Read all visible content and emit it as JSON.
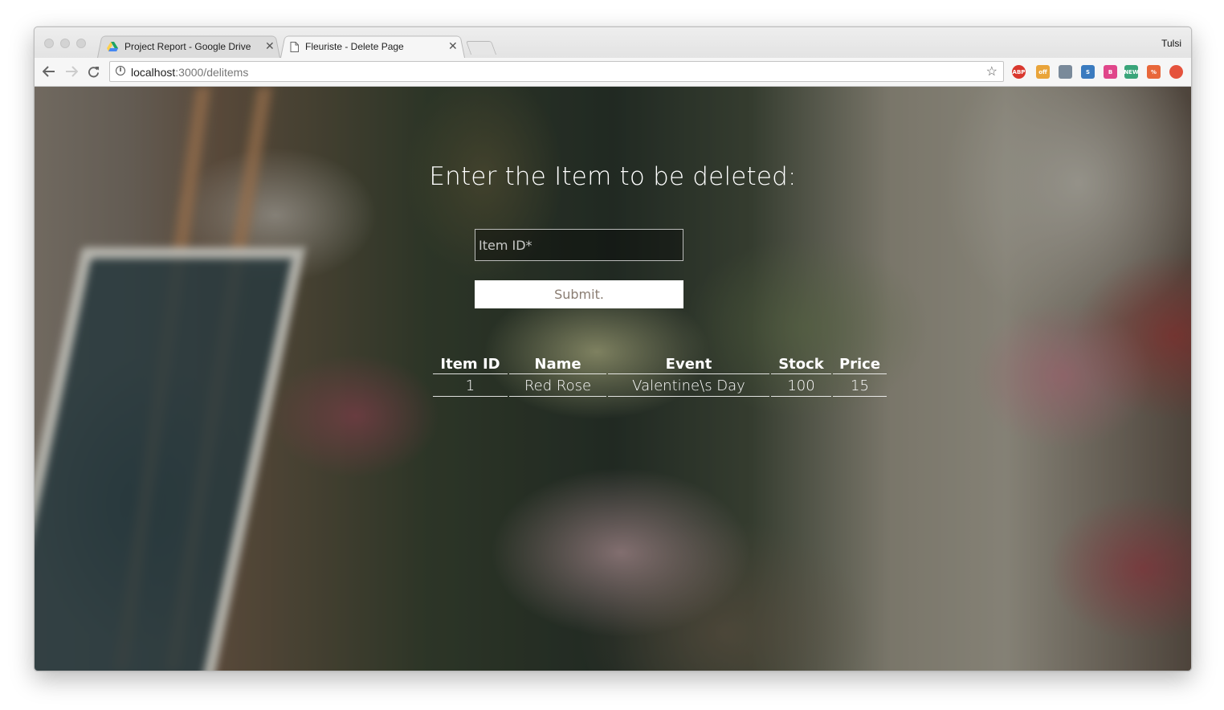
{
  "browser": {
    "tabs": [
      {
        "title": "Project Report - Google Drive",
        "icon": "google-drive-icon",
        "active": false
      },
      {
        "title": "Fleuriste - Delete Page",
        "icon": "document-icon",
        "active": true
      }
    ],
    "profile_name": "Tulsi",
    "url_host": "localhost",
    "url_path": ":3000/delitems",
    "extensions": [
      {
        "name": "adblock-plus-icon",
        "text": "ABP",
        "color": "#d9382e"
      },
      {
        "name": "coupon-icon",
        "text": "off",
        "color": "#e9a43a"
      },
      {
        "name": "extension-tools-icon",
        "text": "",
        "color": "#7a8a9a"
      },
      {
        "name": "extension-s-icon",
        "text": "S",
        "color": "#3b7bbf"
      },
      {
        "name": "extension-pink-icon",
        "text": "B",
        "color": "#e0468a"
      },
      {
        "name": "extension-new-icon",
        "text": "NEW",
        "color": "#3aa57a"
      },
      {
        "name": "extension-orange-icon",
        "text": "%",
        "color": "#e8673a"
      },
      {
        "name": "extension-red-circle-icon",
        "text": "",
        "color": "#e5533d"
      }
    ]
  },
  "page": {
    "heading": "Enter the Item to be deleted:",
    "item_id_placeholder": "Item ID*",
    "submit_label": "Submit.",
    "table": {
      "headers": [
        "Item ID",
        "Name",
        "Event",
        "Stock",
        "Price"
      ],
      "rows": [
        [
          "1",
          "Red Rose",
          "Valentine\\s Day",
          "100",
          "15"
        ]
      ]
    }
  }
}
